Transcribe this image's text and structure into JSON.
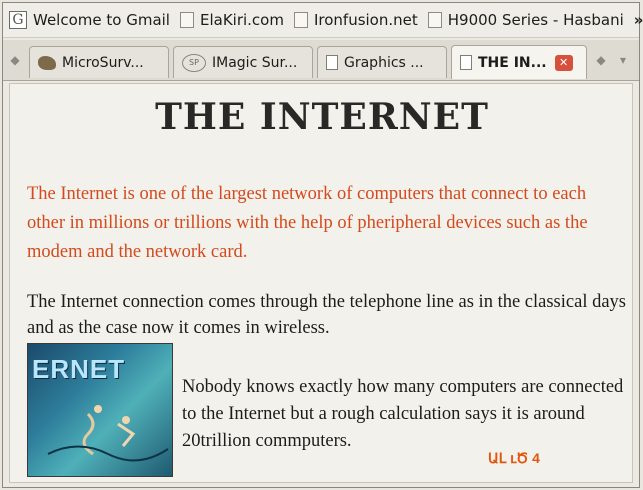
{
  "bookmarks": [
    {
      "label": "Welcome to Gmail",
      "icon": "google-icon"
    },
    {
      "label": "ElaKiri.com",
      "icon": "page-icon"
    },
    {
      "label": "Ironfusion.net",
      "icon": "page-icon"
    },
    {
      "label": "H9000 Series - Hasbani",
      "icon": "page-icon"
    }
  ],
  "bookmarks_more": "»",
  "tabs": [
    {
      "label": "MicroSurv...",
      "icon": "bird-icon"
    },
    {
      "label": "IMagic Sur...",
      "icon": "imagic-icon"
    },
    {
      "label": "Graphics ...",
      "icon": "page-icon"
    },
    {
      "label": "THE IN...",
      "icon": "page-icon",
      "active": true
    }
  ],
  "page": {
    "title": "THE INTERNET",
    "para_red": "The Internet is one of the largest network of computers that connect to each other in millions or trillions with the help of pheripheral devices such as the modem and the network card.",
    "para_black": "The Internet connection comes through the telephone line as in the classical days and as the case now it comes in wireless.",
    "image_word": "ERNET",
    "para_side": "Nobody knows exactly how many computers are connected to the Internet but a rough calculation says it is around 20trillion commputers.",
    "page_number": "ԱԼ ւԾ 4"
  },
  "colors": {
    "red_text": "#d34a1d",
    "close_button": "#d7503c"
  }
}
